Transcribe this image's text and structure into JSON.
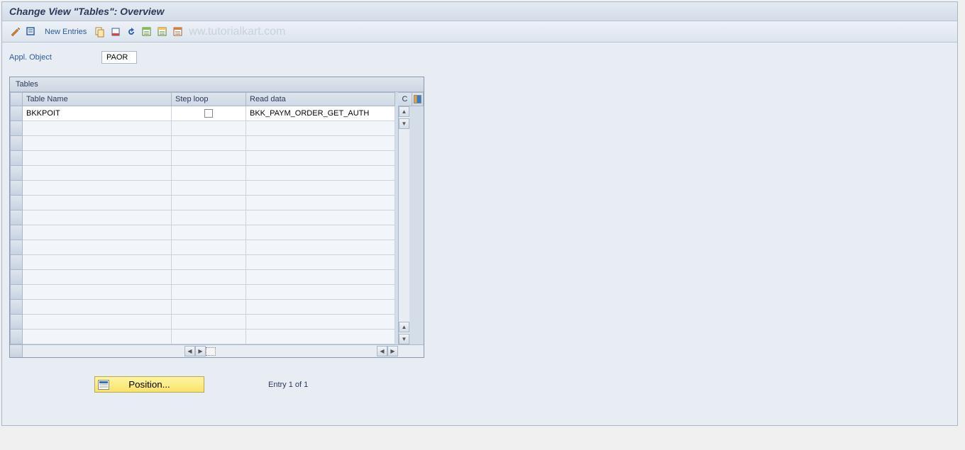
{
  "title": "Change View \"Tables\": Overview",
  "toolbar": {
    "new_entries_label": "New Entries"
  },
  "watermark": "ww.tutorialkart.com",
  "form": {
    "appl_object_label": "Appl. Object",
    "appl_object_value": "PAOR"
  },
  "grid": {
    "title": "Tables",
    "columns": {
      "table_name": "Table Name",
      "step_loop": "Step loop",
      "read_data": "Read data",
      "c": "C"
    },
    "rows": [
      {
        "table_name": "BKKPOIT",
        "step_loop": false,
        "read_data": "BKK_PAYM_ORDER_GET_AUTH"
      }
    ]
  },
  "footer": {
    "position_label": "Position...",
    "entry_text": "Entry 1 of 1"
  }
}
